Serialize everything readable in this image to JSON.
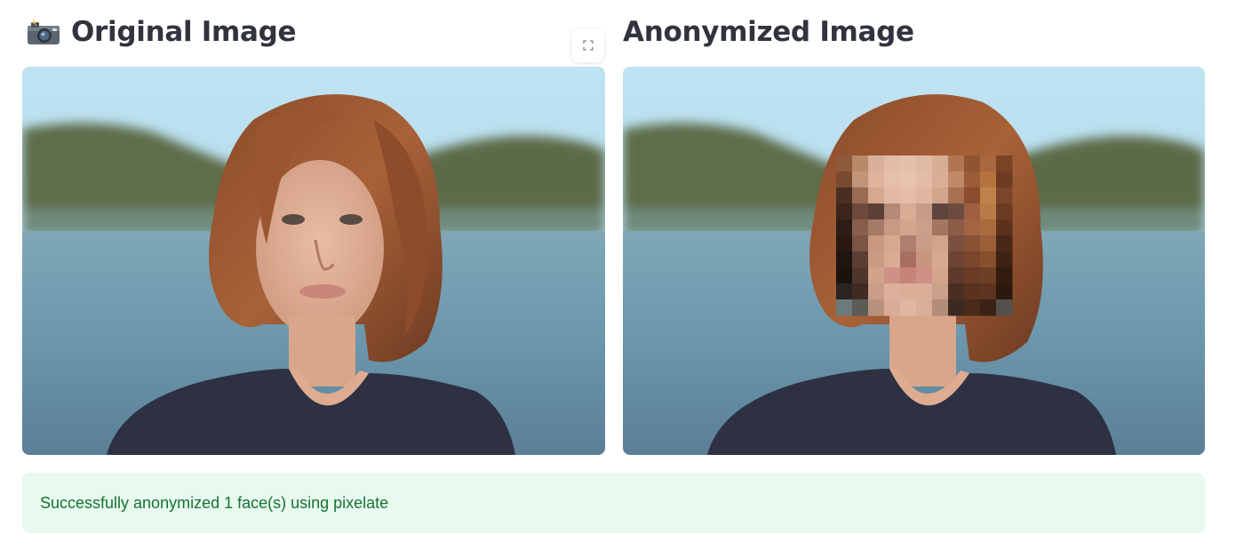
{
  "left_panel": {
    "heading_icon": "camera-with-flash-icon",
    "heading": "Original Image",
    "image_alt": "Portrait of a young woman with shoulder-length auburn hair in front of a blurred lake and hills"
  },
  "right_panel": {
    "heading": "Anonymized Image",
    "image_alt": "Same portrait with the face region pixelated"
  },
  "toolbar": {
    "fullscreen_icon": "fullscreen-icon"
  },
  "status": {
    "message": "Successfully anonymized 1 face(s) using pixelate",
    "accent_color": "#177233",
    "background_color": "#e8f9ee"
  },
  "colors": {
    "heading_text": "#31333f"
  }
}
